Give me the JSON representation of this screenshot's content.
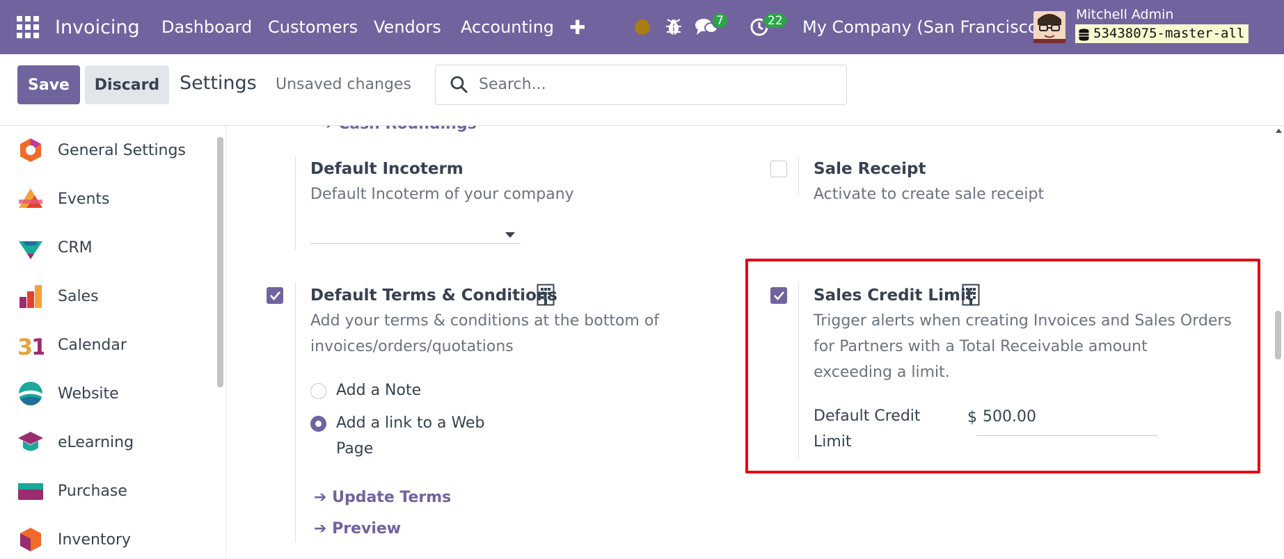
{
  "navbar": {
    "brand": "Invoicing",
    "menu": [
      "Dashboard",
      "Customers",
      "Vendors",
      "Accounting"
    ],
    "add_symbol": "✚",
    "messages_count": "7",
    "activities_count": "22",
    "company": "My Company (San Francisco)",
    "user_name": "Mitchell Admin",
    "database": "53438075-master-all",
    "colors": {
      "bar": "#71639e",
      "badge": "#28a745"
    }
  },
  "control_panel": {
    "save_label": "Save",
    "discard_label": "Discard",
    "title": "Settings",
    "status": "Unsaved changes",
    "search_placeholder": "Search..."
  },
  "sidebar": {
    "items": [
      {
        "label": "General Settings",
        "icon": "general-settings-icon"
      },
      {
        "label": "Events",
        "icon": "events-icon"
      },
      {
        "label": "CRM",
        "icon": "crm-icon"
      },
      {
        "label": "Sales",
        "icon": "sales-icon"
      },
      {
        "label": "Calendar",
        "icon": "calendar-icon"
      },
      {
        "label": "Website",
        "icon": "website-icon"
      },
      {
        "label": "eLearning",
        "icon": "elearning-icon"
      },
      {
        "label": "Purchase",
        "icon": "purchase-icon"
      },
      {
        "label": "Inventory",
        "icon": "inventory-icon"
      }
    ]
  },
  "settings": {
    "cash_roundings_link": "Cash Roundings",
    "default_incoterm": {
      "title": "Default Incoterm",
      "description": "Default Incoterm of your company",
      "value": ""
    },
    "sale_receipt": {
      "title": "Sale Receipt",
      "description": "Activate to create sale receipt",
      "checked": false
    },
    "default_terms": {
      "title": "Default Terms & Conditions",
      "description_line1": "Add your terms & conditions at the bottom of",
      "description_line2": "invoices/orders/quotations",
      "checked": true,
      "options": [
        {
          "label": "Add a Note",
          "selected": false
        },
        {
          "label_line1": "Add a link to a Web",
          "label_line2": "Page",
          "selected": true
        }
      ],
      "update_terms_link": "Update Terms",
      "preview_link": "Preview"
    },
    "sales_credit_limit": {
      "title": "Sales Credit Limit",
      "description_line1": "Trigger alerts when creating Invoices and Sales Orders",
      "description_line2": "for Partners with a Total Receivable amount",
      "description_line3": "exceeding a limit.",
      "checked": true,
      "field_label_line1": "Default Credit",
      "field_label_line2": "Limit",
      "currency": "$",
      "value": "500.00",
      "highlight_color": "#e30b12"
    }
  }
}
